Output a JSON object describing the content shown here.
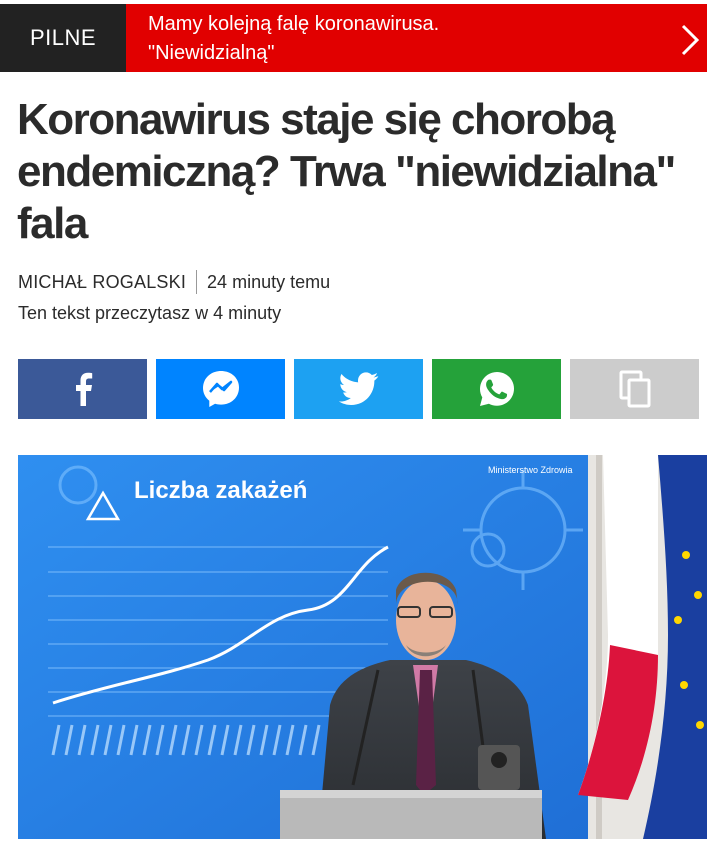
{
  "breaking": {
    "label": "PILNE",
    "line1": "Mamy kolejną falę koronawirusa.",
    "line2": "\"Niewidzialną\""
  },
  "article": {
    "headline": "Koronawirus staje się chorobą endemiczną? Trwa \"niewidzialna\" fala",
    "author": "Michał Rogalski",
    "time": "24 minuty temu",
    "read_time": "Ten tekst przeczytasz w 4 minuty"
  },
  "share": {
    "buttons": [
      {
        "name": "facebook",
        "icon": "facebook-icon",
        "color": "#3b5998"
      },
      {
        "name": "messenger",
        "icon": "messenger-icon",
        "color": "#0084ff"
      },
      {
        "name": "twitter",
        "icon": "twitter-icon",
        "color": "#1da1f2"
      },
      {
        "name": "whatsapp",
        "icon": "whatsapp-icon",
        "color": "#25a23a"
      },
      {
        "name": "copy-link",
        "icon": "copy-icon",
        "color": "#cccccc"
      }
    ]
  },
  "photo": {
    "screen_title": "Liczba zakażeń",
    "ministry": "Ministerstwo Zdrowia"
  },
  "colors": {
    "accent": "#e10000",
    "headline": "#2b2b2b"
  }
}
